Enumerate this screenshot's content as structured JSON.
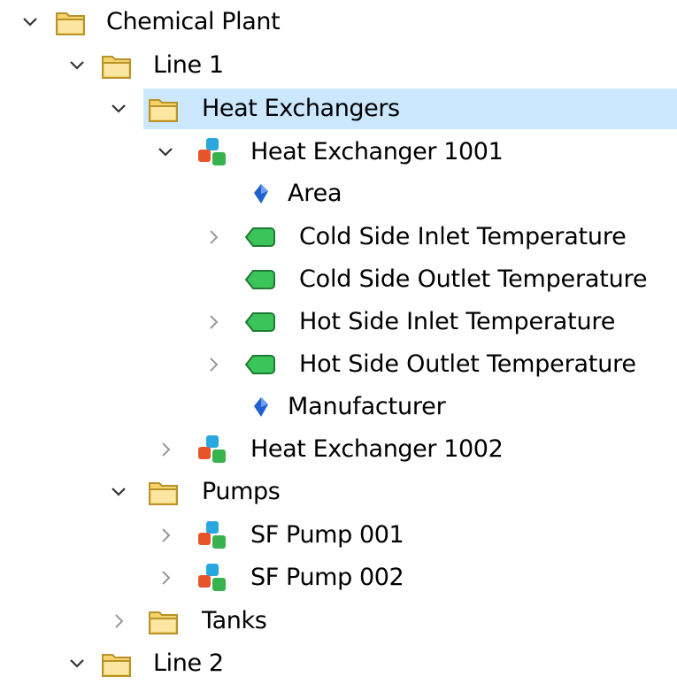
{
  "tree": {
    "nodes": [
      {
        "label": "Chemical Plant",
        "expander": "expanded",
        "icon": "folder-icon"
      },
      {
        "label": "Line 1",
        "expander": "expanded",
        "icon": "folder-icon"
      },
      {
        "label": "Heat Exchangers",
        "expander": "expanded",
        "icon": "folder-icon",
        "selected": true
      },
      {
        "label": "Heat Exchanger 1001",
        "expander": "expanded",
        "icon": "element-icon"
      },
      {
        "label": "Area",
        "expander": "none",
        "icon": "attribute-icon"
      },
      {
        "label": "Cold Side Inlet Temperature",
        "expander": "collapsed",
        "icon": "tag-icon"
      },
      {
        "label": "Cold Side Outlet Temperature",
        "expander": "none",
        "icon": "tag-icon"
      },
      {
        "label": "Hot Side Inlet Temperature",
        "expander": "collapsed",
        "icon": "tag-icon"
      },
      {
        "label": "Hot Side Outlet Temperature",
        "expander": "collapsed",
        "icon": "tag-icon"
      },
      {
        "label": "Manufacturer",
        "expander": "none",
        "icon": "attribute-icon"
      },
      {
        "label": "Heat Exchanger 1002",
        "expander": "collapsed",
        "icon": "element-icon"
      },
      {
        "label": "Pumps",
        "expander": "expanded",
        "icon": "folder-icon"
      },
      {
        "label": "SF Pump 001",
        "expander": "collapsed",
        "icon": "element-icon"
      },
      {
        "label": "SF Pump 002",
        "expander": "collapsed",
        "icon": "element-icon"
      },
      {
        "label": "Tanks",
        "expander": "collapsed",
        "icon": "folder-icon"
      },
      {
        "label": "Line 2",
        "expander": "expanded",
        "icon": "folder-icon"
      }
    ]
  },
  "colors": {
    "selection": "#cce8ff",
    "folder": "#f4d36b",
    "tag": "#3bc45a",
    "attribute": "#1f5fd0"
  }
}
